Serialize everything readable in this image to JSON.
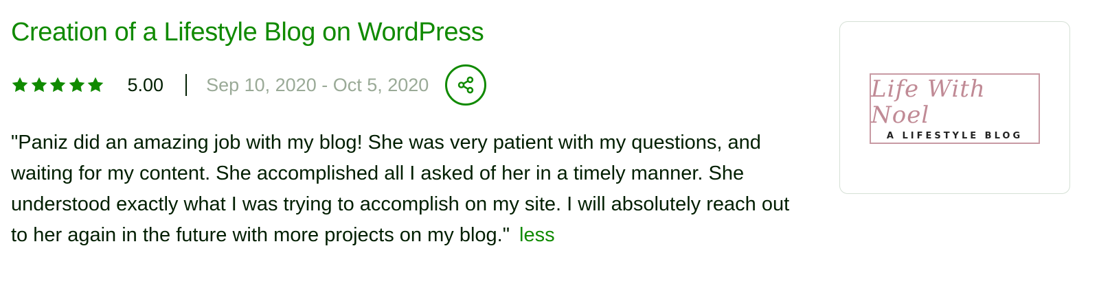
{
  "project": {
    "title": "Creation of a Lifestyle Blog on WordPress",
    "rating_value": "5.00",
    "star_count": 5,
    "date_range": "Sep 10, 2020 - Oct 5, 2020",
    "review_text": "\"Paniz did an amazing job with my blog! She was very patient with my questions, and waiting for my content. She accomplished all I asked of her in a timely manner. She understood exactly what I was trying to accomplish on my site. I will absolutely reach out to her again in the future with more projects on my blog.\"",
    "less_label": "less"
  },
  "thumbnail": {
    "logo_script": "Life With Noel",
    "logo_subtitle": "A LIFESTYLE BLOG"
  },
  "icons": {
    "star": "star-icon",
    "share": "share-icon"
  },
  "colors": {
    "accent_green": "#108a00",
    "text_dark": "#001e00",
    "date_gray": "#9aaa97",
    "logo_pink": "#c08a95",
    "thumb_border": "#d5e0d5"
  }
}
